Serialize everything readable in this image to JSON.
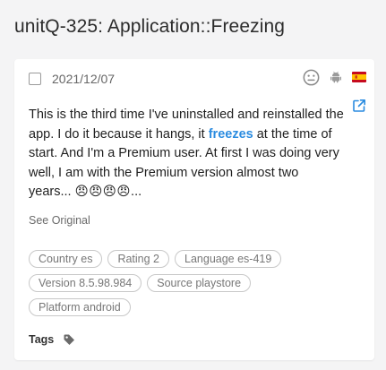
{
  "page": {
    "title": "unitQ-325:  Application::Freezing"
  },
  "card": {
    "date": "2021/12/07",
    "icons": {
      "sentiment": "neutral-face-icon",
      "platform": "android-icon",
      "flag": "spain-flag-icon",
      "open": "external-link-icon",
      "tag": "tag-icon"
    },
    "review": {
      "before": "This is the third time I've uninstalled and reinstalled the app. I do it because it hangs, it ",
      "keyword": "freezes",
      "after": " at the time of start. And I'm a Premium user. At first I was doing very well, I am with the Premium version almost two years... ",
      "emojis": "😠😠😠😠",
      "ellipsis": "..."
    },
    "see_original": "See Original",
    "tags": [
      [
        "Country es",
        "Rating 2",
        "Language es-419"
      ],
      [
        "Version 8.5.98.984",
        "Source playstore"
      ],
      [
        "Platform android"
      ]
    ],
    "tags_label": "Tags"
  },
  "colors": {
    "keyword": "#2b8ce0",
    "background": "#f4f4f5",
    "card": "#ffffff",
    "tag_border": "#c8c8c8"
  }
}
